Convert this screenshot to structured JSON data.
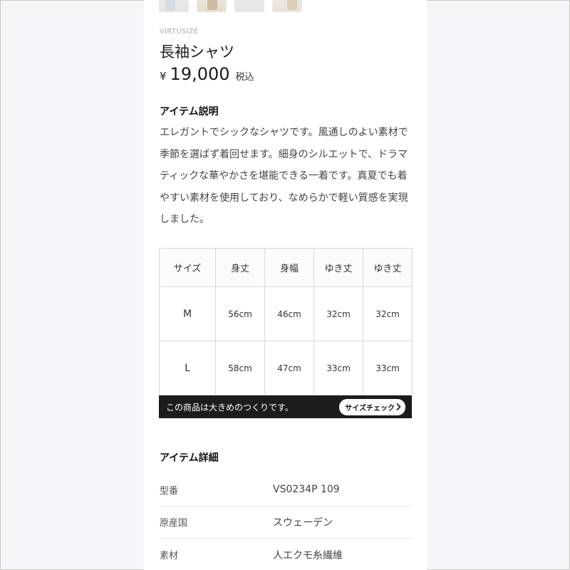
{
  "product": {
    "brand": "VIRTUSIZE",
    "name": "長袖シャツ",
    "currency": "¥",
    "price": "19,000",
    "tax_label": "税込"
  },
  "description": {
    "heading": "アイテム説明",
    "text": "エレガントでシックなシャツです。風通しのよい素材で季節を選ばず着回せます。細身のシルエットで、ドラマティックな華やかさを堪能できる一着です。真夏でも着やすい素材を使用しており、なめらかで軽い質感を実現しました。"
  },
  "size_table": {
    "headers": [
      "サイズ",
      "身丈",
      "身幅",
      "ゆき丈",
      "ゆき丈"
    ],
    "rows": [
      [
        "M",
        "56cm",
        "46cm",
        "32cm",
        "32cm"
      ],
      [
        "L",
        "58cm",
        "47cm",
        "33cm",
        "33cm"
      ]
    ]
  },
  "fit_banner": {
    "text": "この商品は大きめのつくりです。",
    "button_label": "サイズチェック"
  },
  "details": {
    "heading": "アイテム詳細",
    "rows": [
      {
        "label": "型番",
        "value": "VS0234P 109"
      },
      {
        "label": "原産国",
        "value": "スウェーデン"
      },
      {
        "label": "素材",
        "value": "人エクモ糸繊維"
      }
    ]
  },
  "colors": {
    "background": "#f5f6f9",
    "card": "#ffffff",
    "banner": "#1c1c1c"
  },
  "icons": {
    "fit_button": "chevron-right-icon"
  }
}
